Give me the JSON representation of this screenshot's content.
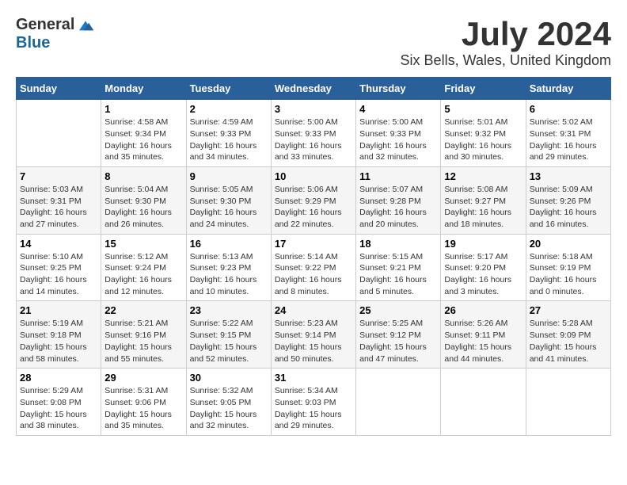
{
  "logo": {
    "general": "General",
    "blue": "Blue"
  },
  "title": {
    "month": "July 2024",
    "location": "Six Bells, Wales, United Kingdom"
  },
  "calendar": {
    "headers": [
      "Sunday",
      "Monday",
      "Tuesday",
      "Wednesday",
      "Thursday",
      "Friday",
      "Saturday"
    ],
    "weeks": [
      [
        {
          "day": "",
          "info": ""
        },
        {
          "day": "1",
          "info": "Sunrise: 4:58 AM\nSunset: 9:34 PM\nDaylight: 16 hours\nand 35 minutes."
        },
        {
          "day": "2",
          "info": "Sunrise: 4:59 AM\nSunset: 9:33 PM\nDaylight: 16 hours\nand 34 minutes."
        },
        {
          "day": "3",
          "info": "Sunrise: 5:00 AM\nSunset: 9:33 PM\nDaylight: 16 hours\nand 33 minutes."
        },
        {
          "day": "4",
          "info": "Sunrise: 5:00 AM\nSunset: 9:33 PM\nDaylight: 16 hours\nand 32 minutes."
        },
        {
          "day": "5",
          "info": "Sunrise: 5:01 AM\nSunset: 9:32 PM\nDaylight: 16 hours\nand 30 minutes."
        },
        {
          "day": "6",
          "info": "Sunrise: 5:02 AM\nSunset: 9:31 PM\nDaylight: 16 hours\nand 29 minutes."
        }
      ],
      [
        {
          "day": "7",
          "info": "Sunrise: 5:03 AM\nSunset: 9:31 PM\nDaylight: 16 hours\nand 27 minutes."
        },
        {
          "day": "8",
          "info": "Sunrise: 5:04 AM\nSunset: 9:30 PM\nDaylight: 16 hours\nand 26 minutes."
        },
        {
          "day": "9",
          "info": "Sunrise: 5:05 AM\nSunset: 9:30 PM\nDaylight: 16 hours\nand 24 minutes."
        },
        {
          "day": "10",
          "info": "Sunrise: 5:06 AM\nSunset: 9:29 PM\nDaylight: 16 hours\nand 22 minutes."
        },
        {
          "day": "11",
          "info": "Sunrise: 5:07 AM\nSunset: 9:28 PM\nDaylight: 16 hours\nand 20 minutes."
        },
        {
          "day": "12",
          "info": "Sunrise: 5:08 AM\nSunset: 9:27 PM\nDaylight: 16 hours\nand 18 minutes."
        },
        {
          "day": "13",
          "info": "Sunrise: 5:09 AM\nSunset: 9:26 PM\nDaylight: 16 hours\nand 16 minutes."
        }
      ],
      [
        {
          "day": "14",
          "info": "Sunrise: 5:10 AM\nSunset: 9:25 PM\nDaylight: 16 hours\nand 14 minutes."
        },
        {
          "day": "15",
          "info": "Sunrise: 5:12 AM\nSunset: 9:24 PM\nDaylight: 16 hours\nand 12 minutes."
        },
        {
          "day": "16",
          "info": "Sunrise: 5:13 AM\nSunset: 9:23 PM\nDaylight: 16 hours\nand 10 minutes."
        },
        {
          "day": "17",
          "info": "Sunrise: 5:14 AM\nSunset: 9:22 PM\nDaylight: 16 hours\nand 8 minutes."
        },
        {
          "day": "18",
          "info": "Sunrise: 5:15 AM\nSunset: 9:21 PM\nDaylight: 16 hours\nand 5 minutes."
        },
        {
          "day": "19",
          "info": "Sunrise: 5:17 AM\nSunset: 9:20 PM\nDaylight: 16 hours\nand 3 minutes."
        },
        {
          "day": "20",
          "info": "Sunrise: 5:18 AM\nSunset: 9:19 PM\nDaylight: 16 hours\nand 0 minutes."
        }
      ],
      [
        {
          "day": "21",
          "info": "Sunrise: 5:19 AM\nSunset: 9:18 PM\nDaylight: 15 hours\nand 58 minutes."
        },
        {
          "day": "22",
          "info": "Sunrise: 5:21 AM\nSunset: 9:16 PM\nDaylight: 15 hours\nand 55 minutes."
        },
        {
          "day": "23",
          "info": "Sunrise: 5:22 AM\nSunset: 9:15 PM\nDaylight: 15 hours\nand 52 minutes."
        },
        {
          "day": "24",
          "info": "Sunrise: 5:23 AM\nSunset: 9:14 PM\nDaylight: 15 hours\nand 50 minutes."
        },
        {
          "day": "25",
          "info": "Sunrise: 5:25 AM\nSunset: 9:12 PM\nDaylight: 15 hours\nand 47 minutes."
        },
        {
          "day": "26",
          "info": "Sunrise: 5:26 AM\nSunset: 9:11 PM\nDaylight: 15 hours\nand 44 minutes."
        },
        {
          "day": "27",
          "info": "Sunrise: 5:28 AM\nSunset: 9:09 PM\nDaylight: 15 hours\nand 41 minutes."
        }
      ],
      [
        {
          "day": "28",
          "info": "Sunrise: 5:29 AM\nSunset: 9:08 PM\nDaylight: 15 hours\nand 38 minutes."
        },
        {
          "day": "29",
          "info": "Sunrise: 5:31 AM\nSunset: 9:06 PM\nDaylight: 15 hours\nand 35 minutes."
        },
        {
          "day": "30",
          "info": "Sunrise: 5:32 AM\nSunset: 9:05 PM\nDaylight: 15 hours\nand 32 minutes."
        },
        {
          "day": "31",
          "info": "Sunrise: 5:34 AM\nSunset: 9:03 PM\nDaylight: 15 hours\nand 29 minutes."
        },
        {
          "day": "",
          "info": ""
        },
        {
          "day": "",
          "info": ""
        },
        {
          "day": "",
          "info": ""
        }
      ]
    ]
  }
}
